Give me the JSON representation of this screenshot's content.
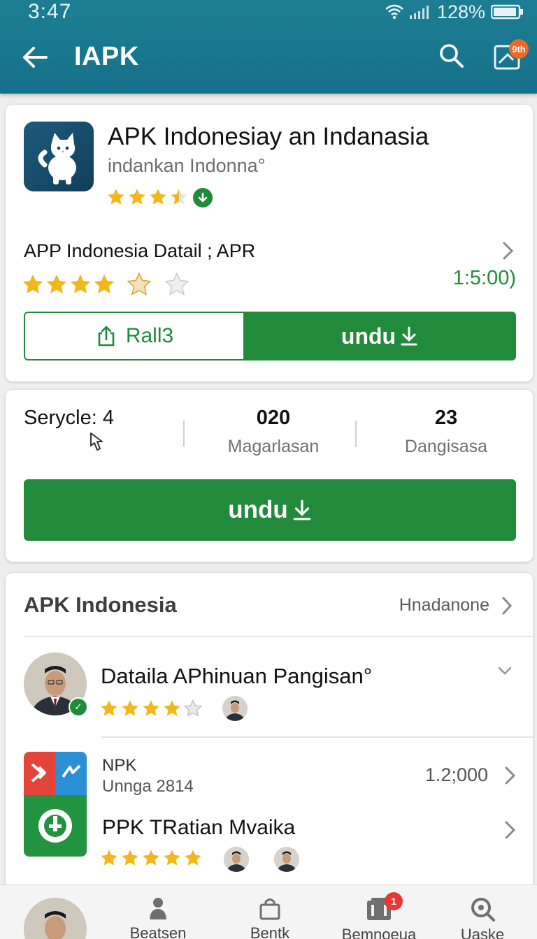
{
  "status_bar": {
    "time": "3:47",
    "battery": "128%"
  },
  "app_bar": {
    "title": "IAPK",
    "notification_badge": "9th"
  },
  "app_card": {
    "name": "APK Indonesiay an Indanasia",
    "subtitle": "indankan Indonna°",
    "rating_stars": 3.5,
    "detail_title": "APP Indonesia Datail ; APR",
    "detail_rating_stars": 4,
    "detail_value": "1:5:00)",
    "secondary_button_label": "Rall3",
    "primary_button_label": "undu"
  },
  "stats_card": {
    "stat1_label": "Serycle: 4",
    "stat2_value": "020",
    "stat2_label": "Magarlasan",
    "stat3_value": "23",
    "stat3_label": "Dangisasa",
    "download_button_label": "undu"
  },
  "list_card": {
    "title": "APK Indonesia",
    "more_label": "Hnadanone",
    "row1": {
      "title": "Dataila APhinuan Pangisan°",
      "rating_stars": 4
    },
    "row2": {
      "title": "NPK",
      "subtitle": "Unnga 2814",
      "value": "1.2;000"
    },
    "row3": {
      "title": "PPK TRatian Mvaika",
      "rating_stars": 5
    }
  },
  "bottom_nav": {
    "items": [
      {
        "label": "Beatsen",
        "icon": "person-icon"
      },
      {
        "label": "Bentk",
        "icon": "bag-icon"
      },
      {
        "label": "Bemnoeua",
        "icon": "cards-icon",
        "badge": "1"
      },
      {
        "label": "Uaske",
        "icon": "search-icon"
      }
    ]
  },
  "colors": {
    "app_bar": "#1b7a90",
    "accent_green": "#218b3b",
    "star": "#f2b71a",
    "badge_orange": "#f06724"
  }
}
